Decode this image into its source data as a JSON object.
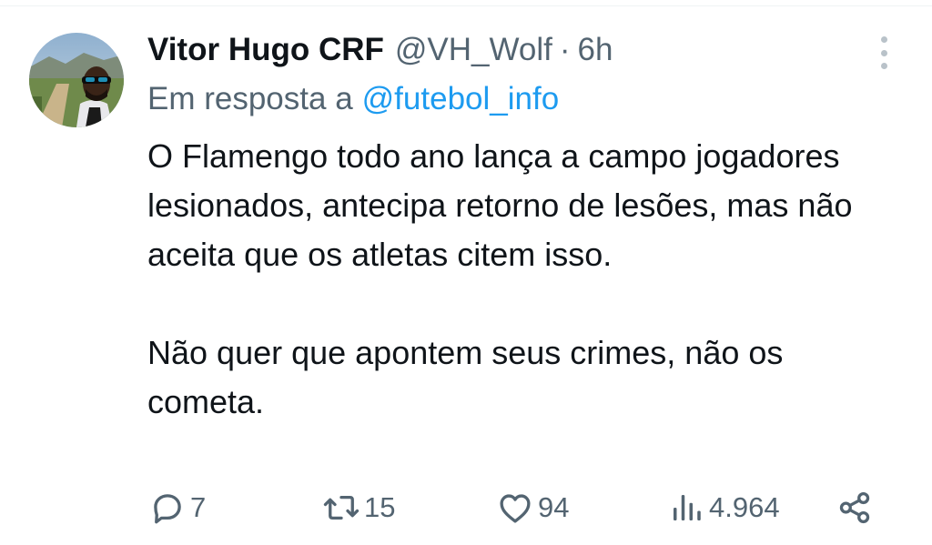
{
  "author": {
    "display_name": "Vitor Hugo CRF",
    "handle": "@VH_Wolf",
    "separator": "·",
    "time": "6h"
  },
  "reply": {
    "prefix": "Em resposta a",
    "to": "@futebol_info"
  },
  "body": {
    "paragraph_1": "O Flamengo todo ano lança a campo jogadores lesionados, antecipa retorno de lesões, mas não aceita que os atletas citem isso.",
    "paragraph_2": "Não quer que apontem seus crimes, não os cometa."
  },
  "actions": {
    "replies": "7",
    "retweets": "15",
    "likes": "94",
    "views": "4.964"
  },
  "icons": {
    "reply": "speech-bubble-icon",
    "retweet": "retweet-arrows-icon",
    "like": "heart-icon",
    "views": "bar-chart-icon",
    "share": "share-nodes-icon",
    "more": "vertical-dots-icon"
  },
  "colors": {
    "text_primary": "#0f1419",
    "text_secondary": "#536471",
    "link": "#1d9bf0"
  }
}
